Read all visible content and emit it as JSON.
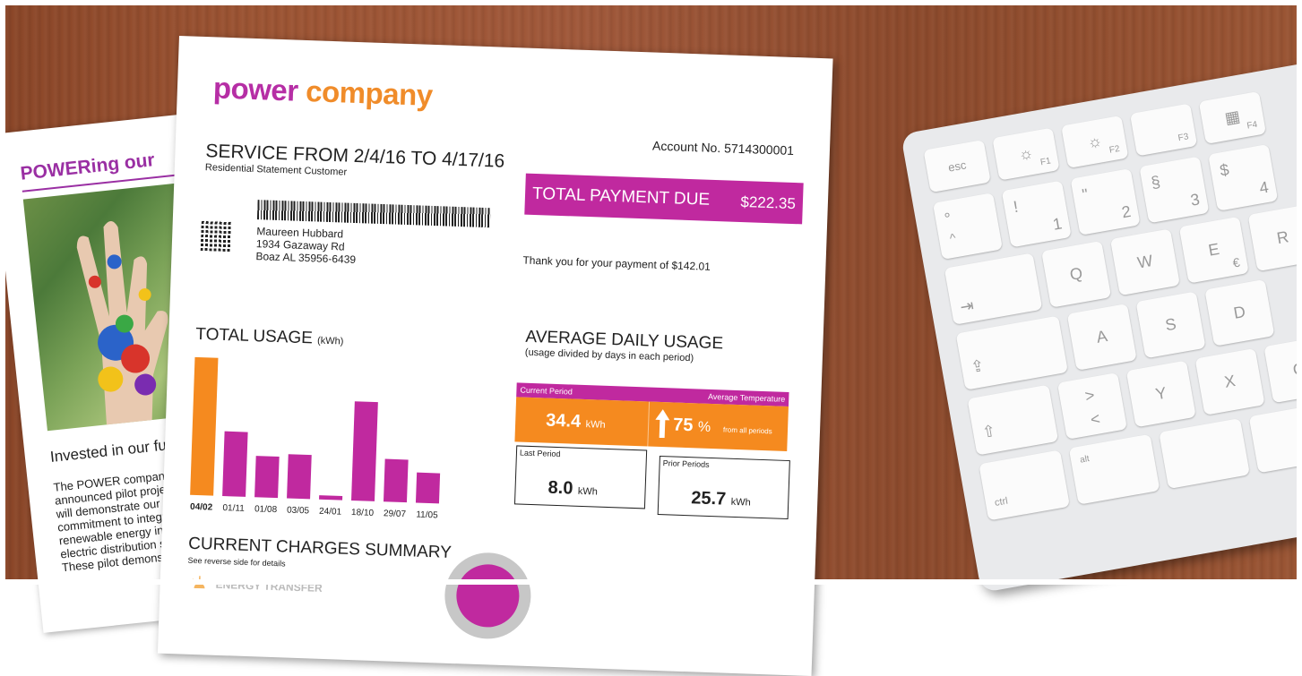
{
  "brochure": {
    "heading": "POWERing our",
    "subheading": "Invested in our futu",
    "body_lines": [
      "The POWER company r",
      "announced pilot projects",
      "will demonstrate our",
      "commitment to integrate",
      "renewable energy into c",
      "electric distribution syst",
      "These pilot demonstrat"
    ]
  },
  "bill": {
    "logo_part1": "p⁵wer",
    "logo_word1": "power",
    "logo_word2": "company",
    "account": "Account No. 5714300001",
    "service": "SERVICE FROM 2/4/16 TO  4/17/16",
    "customer_type": "Residential Statement Customer",
    "address": [
      "Maureen Hubbard",
      "1934 Gazaway Rd",
      "Boaz AL  35956-6439"
    ],
    "total_label": "TOTAL PAYMENT DUE",
    "total_amount": "$222.35",
    "thanks": "Thank you for your payment of $142.01",
    "usage_title": "TOTAL USAGE",
    "usage_unit": "(kWh)",
    "avg_title": "AVERAGE DAILY USAGE",
    "avg_subtitle": "(usage divided by days in each period)",
    "current_period_label": "Current Period",
    "avg_temp_label": "Average Temperature",
    "current_value": "34.4",
    "current_unit": "kWh",
    "temp_value": "75",
    "temp_unit": "%",
    "temp_note": "from all periods",
    "last_period_label": "Last Period",
    "last_value": "8.0",
    "last_unit": "kWh",
    "prior_label": "Prior Periods",
    "prior_value": "25.7",
    "prior_unit": "kWh",
    "charges_title": "CURRENT CHARGES SUMMARY",
    "charges_sub": "See reverse side for details",
    "energy_label": "ENERGY TRANSFER"
  },
  "chart_data": {
    "type": "bar",
    "categories": [
      "04/02",
      "01/11",
      "01/08",
      "03/05",
      "24/01",
      "18/10",
      "29/07",
      "11/05"
    ],
    "values": [
      100,
      47,
      30,
      32,
      3,
      72,
      31,
      22
    ],
    "ylim": [
      0,
      100
    ],
    "colors": [
      "#f58a1f",
      "#c0299f",
      "#c0299f",
      "#c0299f",
      "#c0299f",
      "#c0299f",
      "#c0299f",
      "#c0299f"
    ]
  },
  "keyboard": {
    "keys": [
      {
        "main": "esc",
        "sub": ""
      },
      {
        "main": "☼",
        "sub": "F1"
      },
      {
        "main": "☼",
        "sub": "F2"
      },
      {
        "main": "",
        "sub": "F3"
      },
      {
        "main": "▦",
        "sub": "F4"
      },
      {
        "main": "°",
        "sub": "^"
      },
      {
        "main": "!",
        "sub": "1"
      },
      {
        "main": "\"",
        "sub": "2"
      },
      {
        "main": "§",
        "sub": "3"
      },
      {
        "main": "$",
        "sub": "4"
      },
      {
        "main": "⇥",
        "sub": ""
      },
      {
        "main": "Q",
        "sub": ""
      },
      {
        "main": "W",
        "sub": ""
      },
      {
        "main": "E",
        "sub": "€"
      },
      {
        "main": "R",
        "sub": ""
      },
      {
        "main": "⇪",
        "sub": ""
      },
      {
        "main": "A",
        "sub": ""
      },
      {
        "main": "S",
        "sub": ""
      },
      {
        "main": "D",
        "sub": ""
      },
      {
        "main": "⇧",
        "sub": ""
      },
      {
        "main": ">",
        "sub": "<"
      },
      {
        "main": "Y",
        "sub": ""
      },
      {
        "main": "X",
        "sub": ""
      },
      {
        "main": "C",
        "sub": ""
      },
      {
        "main": "ctrl",
        "sub": ""
      },
      {
        "main": "alt",
        "sub": ""
      }
    ]
  }
}
